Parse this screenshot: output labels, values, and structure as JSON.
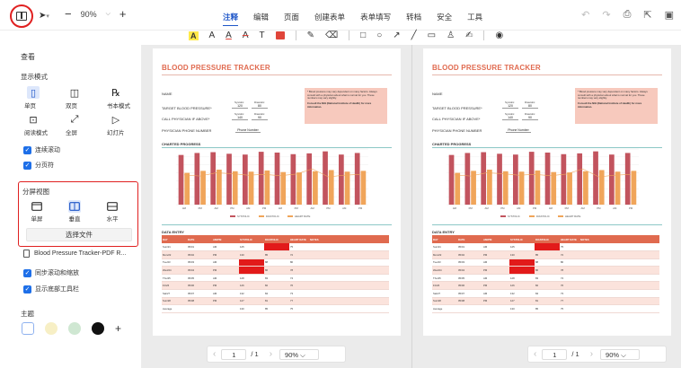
{
  "toolbar": {
    "zoom_value": "90%",
    "zoom_minus": "−",
    "zoom_plus": "+",
    "select_arrow": "▾",
    "menu": [
      "注释",
      "编辑",
      "页面",
      "创建表单",
      "表单填写",
      "转档",
      "安全",
      "工具"
    ],
    "active_menu_index": 0,
    "accent_color": "#1e56c8",
    "highlight_color": "#e02020"
  },
  "annotation_tools": {
    "highlight_text": "A",
    "text_a": "A",
    "underline_a": "A",
    "strike_a": "A",
    "text_tool": "T"
  },
  "sidebar": {
    "title": "查看",
    "display_mode_title": "显示模式",
    "modes_row1": [
      {
        "label": "单页",
        "icon": "single-page-icon",
        "selected": true
      },
      {
        "label": "双页",
        "icon": "double-page-icon",
        "selected": false
      },
      {
        "label": "书本模式",
        "icon": "book-mode-icon",
        "selected": false
      }
    ],
    "modes_row2": [
      {
        "label": "阅读模式",
        "icon": "reading-mode-icon",
        "selected": false
      },
      {
        "label": "全屏",
        "icon": "fullscreen-icon",
        "selected": false
      },
      {
        "label": "幻灯片",
        "icon": "slideshow-icon",
        "selected": false
      }
    ],
    "continuous_scroll": "连续滚动",
    "page_break": "分页符",
    "split_title": "分屏视图",
    "split_options": [
      {
        "label": "单屏",
        "selected": false
      },
      {
        "label": "垂直",
        "selected": true
      },
      {
        "label": "水平",
        "selected": false
      }
    ],
    "choose_file": "选择文件",
    "file_name": "Blood Pressure Tracker-PDF R...",
    "sync_scroll": "同步滚动和缩放",
    "show_bottom_toolbar": "显示底部工具栏",
    "theme_title": "主题",
    "theme_colors": [
      "#ffffff",
      "#f7efc5",
      "#cfe7d2",
      "#111111"
    ],
    "add_theme": "+"
  },
  "document": {
    "title": "BLOOD PRESSURE TRACKER",
    "name_label": "NAME",
    "target_label": "TARGET BLOOD PRESSURE*",
    "call_label": "CALL PHYSICIAN IF ABOVE*",
    "phone_label": "PHYSICIAN PHONE NUMBER",
    "phone_value": "Phone Number",
    "systolic_hdr": "Systolic",
    "diastolic_hdr": "Diastolic",
    "target_sys": "120",
    "target_dia": "80",
    "call_sys": "140",
    "call_dia": "90",
    "note_text": "* Blood pressure may vary dependent on many factors. Always consult with a physician about what is normal for you. These numbers may vary slightly.",
    "note_bold": "Consult the NIH (National Institute of Health) for more information.",
    "chart_title": "CHARTED PROGRESS",
    "data_title": "DATA ENTRY",
    "table_headers": [
      "DAY",
      "DATE",
      "AM/PM",
      "SYSTOLIC",
      "DIASTOLIC",
      "HEART RATE",
      "NOTES"
    ],
    "table_rows": [
      [
        "Sun/21",
        "05/01",
        "AM",
        "125",
        "",
        "75",
        ""
      ],
      [
        "Mon/22",
        "05/02",
        "PM",
        "130",
        "85",
        "72",
        ""
      ],
      [
        "Tue/23",
        "05/03",
        "AM",
        "",
        "88",
        "80",
        ""
      ],
      [
        "Wed/24",
        "05/04",
        "PM",
        "",
        "86",
        "78",
        ""
      ],
      [
        "Thu/25",
        "05/05",
        "AM",
        "128",
        "83",
        "74",
        ""
      ],
      [
        "Fri/26",
        "05/06",
        "PM",
        "126",
        "82",
        "76",
        ""
      ],
      [
        "Sat/27",
        "05/07",
        "AM",
        "132",
        "84",
        "73",
        ""
      ],
      [
        "Sun/28",
        "05/08",
        "PM",
        "127",
        "81",
        "77",
        ""
      ],
      [
        "Average",
        "",
        "",
        "130",
        "85",
        "75",
        ""
      ]
    ]
  },
  "chart_data": {
    "type": "bar",
    "categories": [
      "AM",
      "PM",
      "AM",
      "PM",
      "AM",
      "PM",
      "AM",
      "PM",
      "AM",
      "PM",
      "AM",
      "PM"
    ],
    "ylim": [
      0,
      140
    ],
    "series": [
      {
        "name": "SYSTOLIC",
        "color": "#c2545e",
        "values": [
          125,
          130,
          132,
          128,
          126,
          133,
          131,
          127,
          129,
          134,
          126,
          130
        ]
      },
      {
        "name": "DIASTOLIC",
        "color": "#f0a55a",
        "values": [
          80,
          85,
          88,
          84,
          83,
          86,
          82,
          81,
          84,
          87,
          83,
          85
        ]
      },
      {
        "name": "HEART RATE",
        "color": "#f0a55a",
        "values": [
          75,
          72,
          80,
          78,
          74,
          76,
          73,
          77,
          90,
          70,
          74,
          76
        ]
      }
    ]
  },
  "pager": {
    "prev": "‹",
    "page": "1",
    "total": "/ 1",
    "next": "›",
    "zoom": "90%"
  }
}
